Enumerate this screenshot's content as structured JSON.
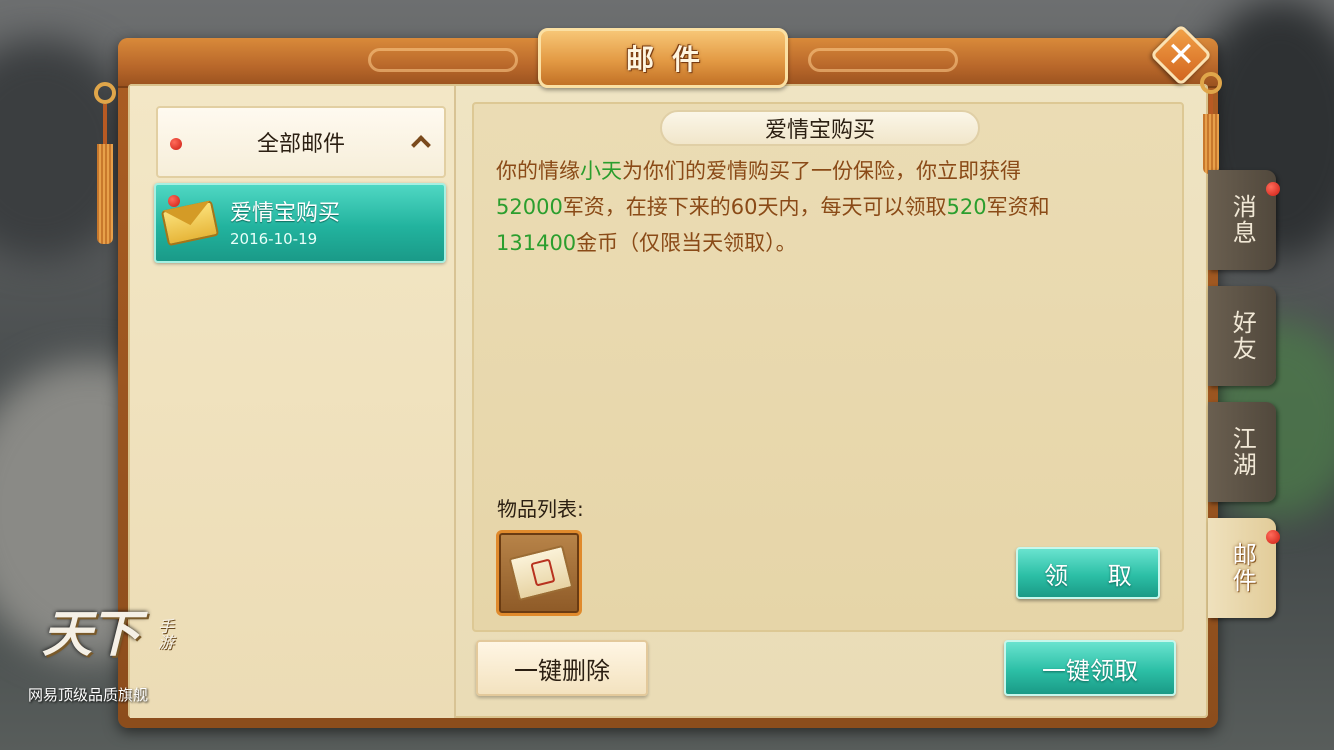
{
  "window": {
    "title": "邮件"
  },
  "left_panel": {
    "header_label": "全部邮件",
    "mails": [
      {
        "title": "爱情宝购买",
        "date": "2016-10-19",
        "unread": true
      }
    ]
  },
  "mail_detail": {
    "subject": "爱情宝购买",
    "body": {
      "p1": "你的情缘",
      "partner": "小天",
      "p2": "为你们的爱情购买了一份保险，你立即获得",
      "amount1": "52000",
      "p3": "军资，在接下来的60天内，每天可以领取",
      "amount2": "520",
      "p4": "军资和",
      "amount3": "131400",
      "p5": "金币（仅限当天领取）。"
    },
    "items_label": "物品列表:",
    "claim_label": "领 取"
  },
  "footer": {
    "delete_all_label": "一键删除",
    "claim_all_label": "一键领取"
  },
  "side_tabs": [
    {
      "label": "消息",
      "badge": true
    },
    {
      "label": "好友",
      "badge": false
    },
    {
      "label": "江湖",
      "badge": false
    },
    {
      "label": "邮件",
      "badge": true,
      "active": true
    }
  ],
  "logo": {
    "main": "天下",
    "sub": "手游",
    "slogan": "网易顶级品质旗舰"
  },
  "colors": {
    "frame_orange": "#b8672a",
    "parchment": "#ebdcb4",
    "teal_button": "#2cbfa6",
    "body_text": "#8a4a17",
    "highlight_green": "#2b9e2e",
    "badge_red": "#cc1c12"
  },
  "icons": {
    "close": "close-icon",
    "collapse": "chevron-up-icon",
    "mail": "envelope-icon",
    "item": "military-fund-ticket-icon"
  }
}
